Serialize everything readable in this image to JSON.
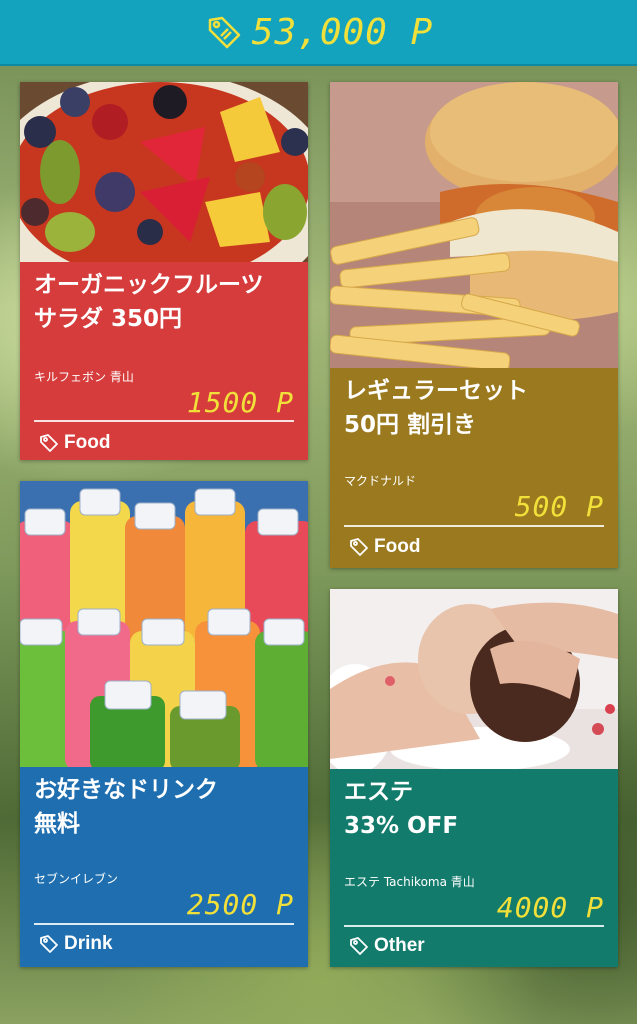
{
  "header": {
    "points": "53,000 P"
  },
  "cards": [
    {
      "title": "オーガニックフルーツ\nサラダ 350円",
      "shop": "キルフェボン 青山",
      "price": "1500 P",
      "category": "Food",
      "color": "#d53c3b"
    },
    {
      "title": "レギュラーセット\n50円 割引き",
      "shop": "マクドナルド",
      "price": "500 P",
      "category": "Food",
      "color": "#9b7a1f"
    },
    {
      "title": "お好きなドリンク\n無料",
      "shop": "セブンイレブン",
      "price": "2500 P",
      "category": "Drink",
      "color": "#1f6fb0"
    },
    {
      "title": "エステ\n33% OFF",
      "shop": "エステ Tachikoma 青山",
      "price": "4000 P",
      "category": "Other",
      "color": "#137b6b"
    }
  ],
  "icons": {
    "header": "price-tag-icon",
    "category": "price-tag-icon"
  },
  "colors": {
    "header_bg": "#14a3bf",
    "points_text": "#f2e03a"
  }
}
